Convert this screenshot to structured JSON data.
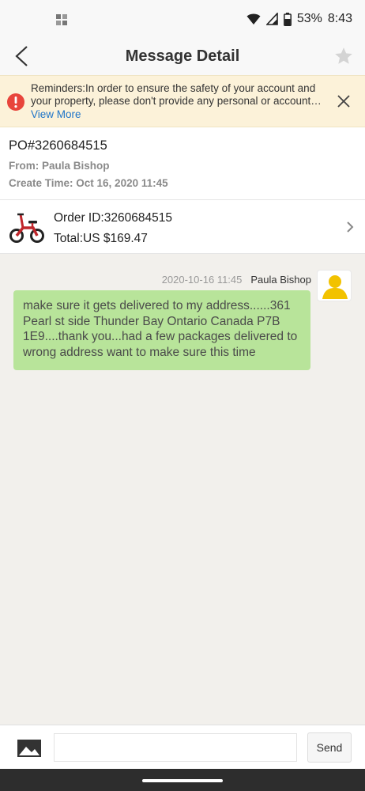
{
  "status_bar": {
    "battery": "53%",
    "time": "8:43",
    "icons": [
      "app-notification-icon",
      "wifi-icon",
      "signal-icon",
      "battery-icon"
    ]
  },
  "header": {
    "title": "Message Detail",
    "back_icon": "chevron-left-icon",
    "star_icon": "star-icon"
  },
  "reminder": {
    "line1": "Reminders:In order to ensure the safety of your account and",
    "line2": "your property, please don't provide any personal or account i...",
    "link": "View More",
    "icon": "alert-icon",
    "close_icon": "close-icon"
  },
  "po": {
    "number": "PO#3260684515",
    "from": "From: Paula Bishop",
    "create_time": "Create Time: Oct 16, 2020 11:45"
  },
  "order": {
    "id": "Order ID:3260684515",
    "total": "Total:US $169.47",
    "thumbnail": "electric-bike-thumbnail",
    "chevron_icon": "chevron-right-icon"
  },
  "messages": [
    {
      "timestamp": "2020-10-16 11:45",
      "sender": "Paula Bishop",
      "text": "make sure it gets delivered to my address......361 Pearl st side Thunder Bay Ontario Canada P7B 1E9....thank you...had a few packages delivered to wrong address want to make sure this time"
    }
  ],
  "composer": {
    "placeholder": "",
    "send_label": "Send",
    "image_icon": "image-icon"
  },
  "colors": {
    "reminder_bg": "#fcf2d9",
    "alert_red": "#e8453c",
    "link_blue": "#1e74c8",
    "bubble_green": "#b8e49a",
    "avatar_yellow": "#f2c200",
    "chat_bg": "#f2f0ec"
  }
}
